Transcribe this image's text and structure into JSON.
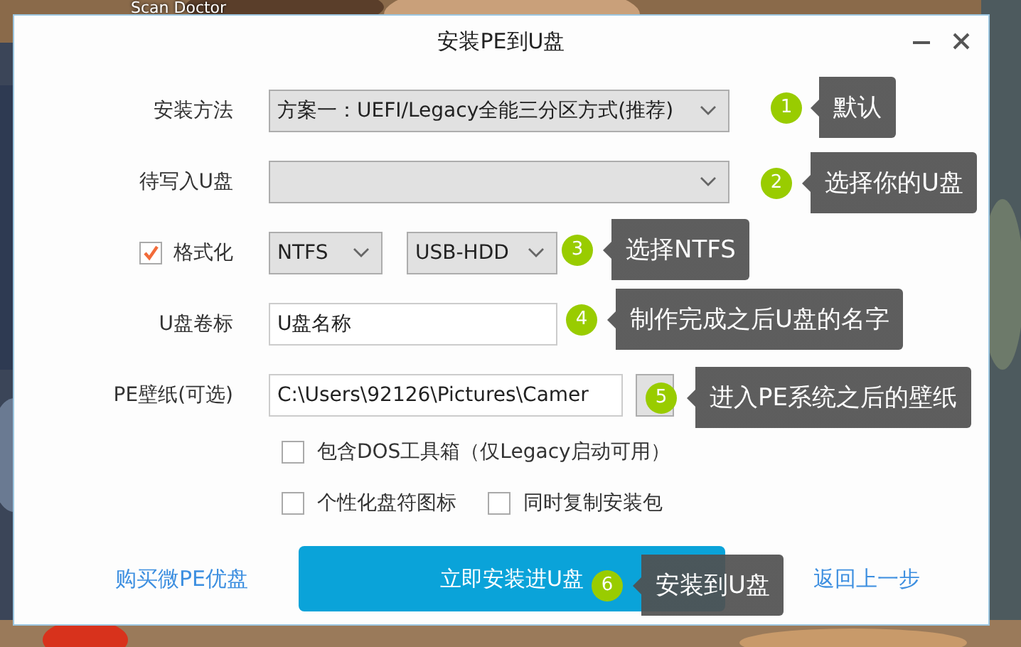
{
  "desktop": {
    "kind": "picture",
    "icon_label": "Scan Doctor"
  },
  "window": {
    "title": "安装PE到U盘"
  },
  "install_method": {
    "label": "安装方法",
    "value": "方案一：UEFI/Legacy全能三分区方式(推荐)"
  },
  "target_drive": {
    "label": "待写入U盘"
  },
  "format": {
    "label": "格式化",
    "checked": true,
    "filesystem": "NTFS",
    "mode": "USB-HDD"
  },
  "volume_label": {
    "label": "U盘卷标",
    "value": "U盘名称"
  },
  "wallpaper": {
    "label": "PE壁纸(可选)",
    "value": "C:\\Users\\92126\\Pictures\\Camer"
  },
  "options": [
    {
      "label": "包含DOS工具箱（仅Legacy启动可用）",
      "checked": false
    },
    {
      "label": "个性化盘符图标",
      "checked": false
    },
    {
      "label": "同时复制安装包",
      "checked": false
    }
  ],
  "footer": {
    "buy_link": "购买微PE优盘",
    "install_button": "立即安装进U盘",
    "back_link": "返回上一步"
  },
  "annotations": [
    {
      "number": "1",
      "text": "默认"
    },
    {
      "number": "2",
      "text": "选择你的U盘"
    },
    {
      "number": "3",
      "text": "选择NTFS"
    },
    {
      "number": "4",
      "text": "制作完成之后U盘的名字"
    },
    {
      "number": "5",
      "text": "进入PE系统之后的壁纸"
    },
    {
      "number": "6",
      "text": "安装到U盘"
    }
  ]
}
